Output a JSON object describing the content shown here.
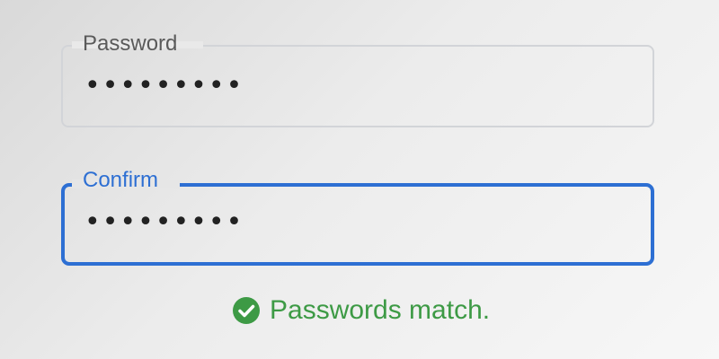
{
  "password": {
    "label": "Password",
    "value": "•••••••••"
  },
  "confirm": {
    "label": "Confirm",
    "value": "•••••••••"
  },
  "status": {
    "icon": "check-circle-icon",
    "message": "Passwords match.",
    "color": "#3d9a45"
  },
  "colors": {
    "focus_accent": "#2d6fd3",
    "idle_border": "#d2d4d8"
  }
}
